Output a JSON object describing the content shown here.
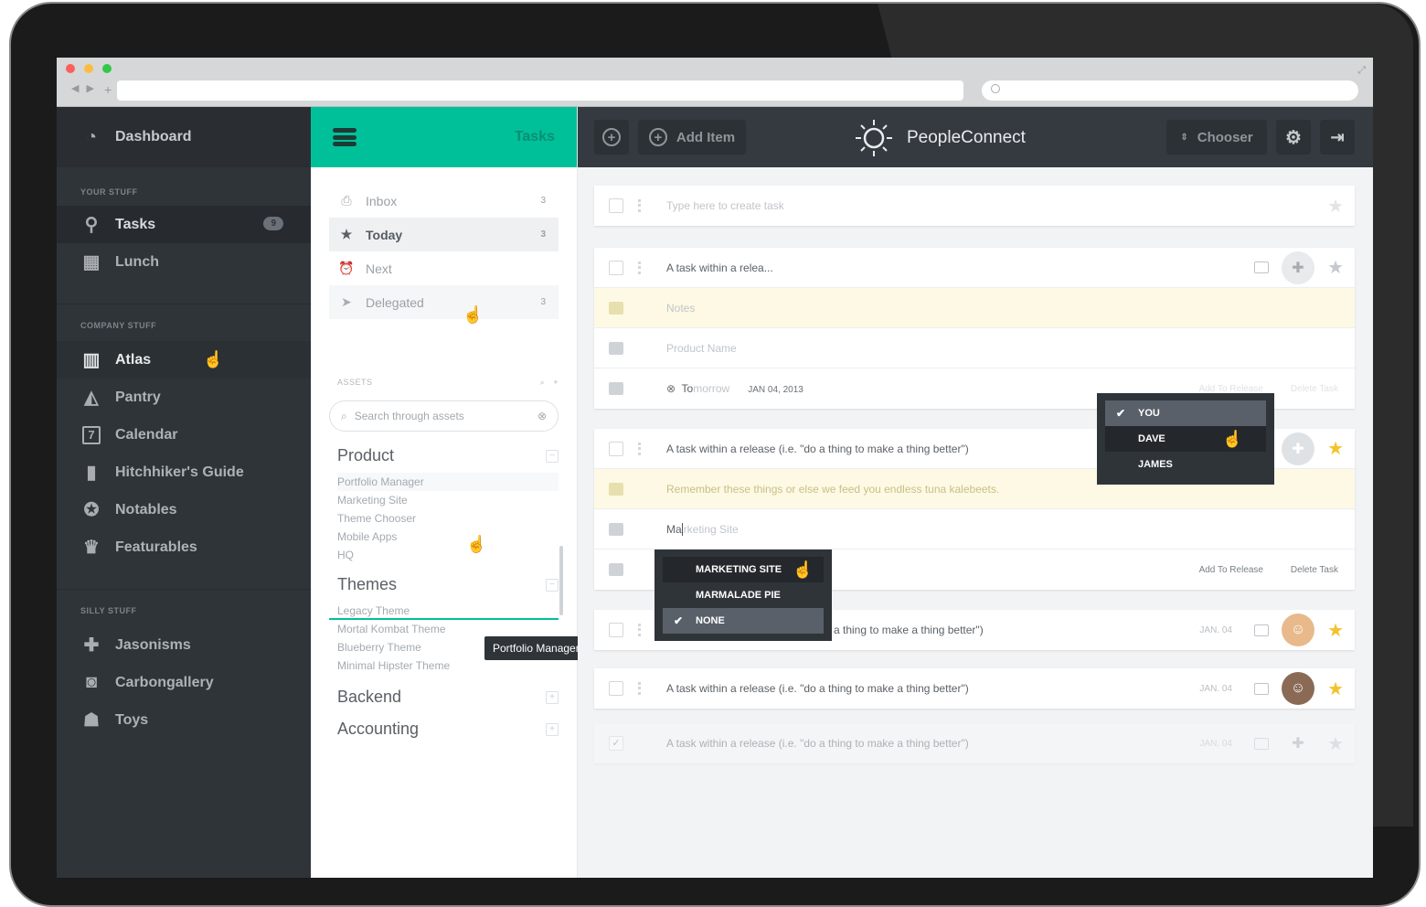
{
  "app": {
    "name": "PeopleConnect",
    "colors": {
      "accent": "#00c09a",
      "sidebar": "#2f3439",
      "star": "#f4c22b"
    }
  },
  "sidebar": {
    "top": {
      "label": "Dashboard",
      "icon": "dashboard-icon"
    },
    "sections": [
      {
        "title": "YOUR STUFF",
        "items": [
          {
            "label": "Tasks",
            "icon": "map-pin-icon",
            "badge": "9"
          },
          {
            "label": "Lunch",
            "icon": "lunch-icon"
          }
        ]
      },
      {
        "title": "COMPANY STUFF",
        "items": [
          {
            "label": "Atlas",
            "icon": "map-icon"
          },
          {
            "label": "Pantry",
            "icon": "cake-icon"
          },
          {
            "label": "Calendar",
            "icon": "calendar-icon",
            "day": "7"
          },
          {
            "label": "Hitchhiker's Guide",
            "icon": "book-icon"
          },
          {
            "label": "Notables",
            "icon": "award-icon"
          },
          {
            "label": "Featurables",
            "icon": "trophy-icon"
          }
        ]
      },
      {
        "title": "SILLY STUFF",
        "items": [
          {
            "label": "Jasonisms",
            "icon": "puzzle-icon"
          },
          {
            "label": "Carbongallery",
            "icon": "camera-icon"
          },
          {
            "label": "Toys",
            "icon": "toy-icon"
          }
        ]
      }
    ]
  },
  "tasks_panel": {
    "title": "Tasks",
    "nav": [
      {
        "label": "Inbox",
        "count": "3",
        "icon": "inbox-icon"
      },
      {
        "label": "Today",
        "count": "3",
        "icon": "star-icon"
      },
      {
        "label": "Next",
        "count": "",
        "icon": "alarm-icon"
      },
      {
        "label": "Delegated",
        "count": "3",
        "icon": "send-icon"
      }
    ],
    "assets_title": "ASSETS",
    "search_placeholder": "Search through assets",
    "groups": [
      {
        "name": "Product",
        "items": [
          "Portfolio Manager",
          "Marketing Site",
          "Theme Chooser",
          "Mobile Apps",
          "HQ"
        ]
      },
      {
        "name": "Themes",
        "items": [
          "Legacy Theme",
          "Mortal Kombat Theme",
          "Blueberry Theme",
          "Minimal Hipster Theme"
        ]
      },
      {
        "name": "Backend",
        "items": []
      },
      {
        "name": "Accounting",
        "items": []
      }
    ],
    "tooltip": "Portfolio Manager"
  },
  "topbar": {
    "add_item": "Add Item",
    "chooser": "Chooser"
  },
  "main": {
    "new_task_placeholder": "Type here to create task",
    "card1": {
      "title": "A task within a relea...",
      "notes_placeholder": "Notes",
      "product_placeholder": "Product Name",
      "due_typed": "To",
      "due_hint": "morrow",
      "date": "JAN 04, 2013",
      "add_to_release": "Add To Release",
      "delete_task": "Delete Task"
    },
    "card2": {
      "title": "A task within a release (i.e. \"do a thing to make a thing better\")",
      "note": "Remember these things or else we feed you endless tuna kalebeets.",
      "product_typed": "Ma",
      "product_hint": "rketing Site",
      "add_to_release": "Add To Release",
      "delete_task": "Delete Task"
    },
    "assignee_dropdown": [
      {
        "label": "YOU",
        "selected": true
      },
      {
        "label": "DAVE",
        "selected": false
      },
      {
        "label": "JAMES",
        "selected": false
      }
    ],
    "product_dropdown": [
      {
        "label": "MARKETING SITE",
        "selected": false
      },
      {
        "label": "MARMALADE PIE",
        "selected": false
      },
      {
        "label": "NONE",
        "selected": true
      }
    ],
    "rows": [
      {
        "title": "a thing to make a thing better\")",
        "date": "JAN. 04"
      },
      {
        "title": "A task within a release (i.e. \"do a thing to make a thing better\")",
        "date": "JAN. 04"
      },
      {
        "title": "A task within a release (i.e. \"do a thing to make a thing better\")",
        "date": "JAN. 04"
      }
    ]
  }
}
